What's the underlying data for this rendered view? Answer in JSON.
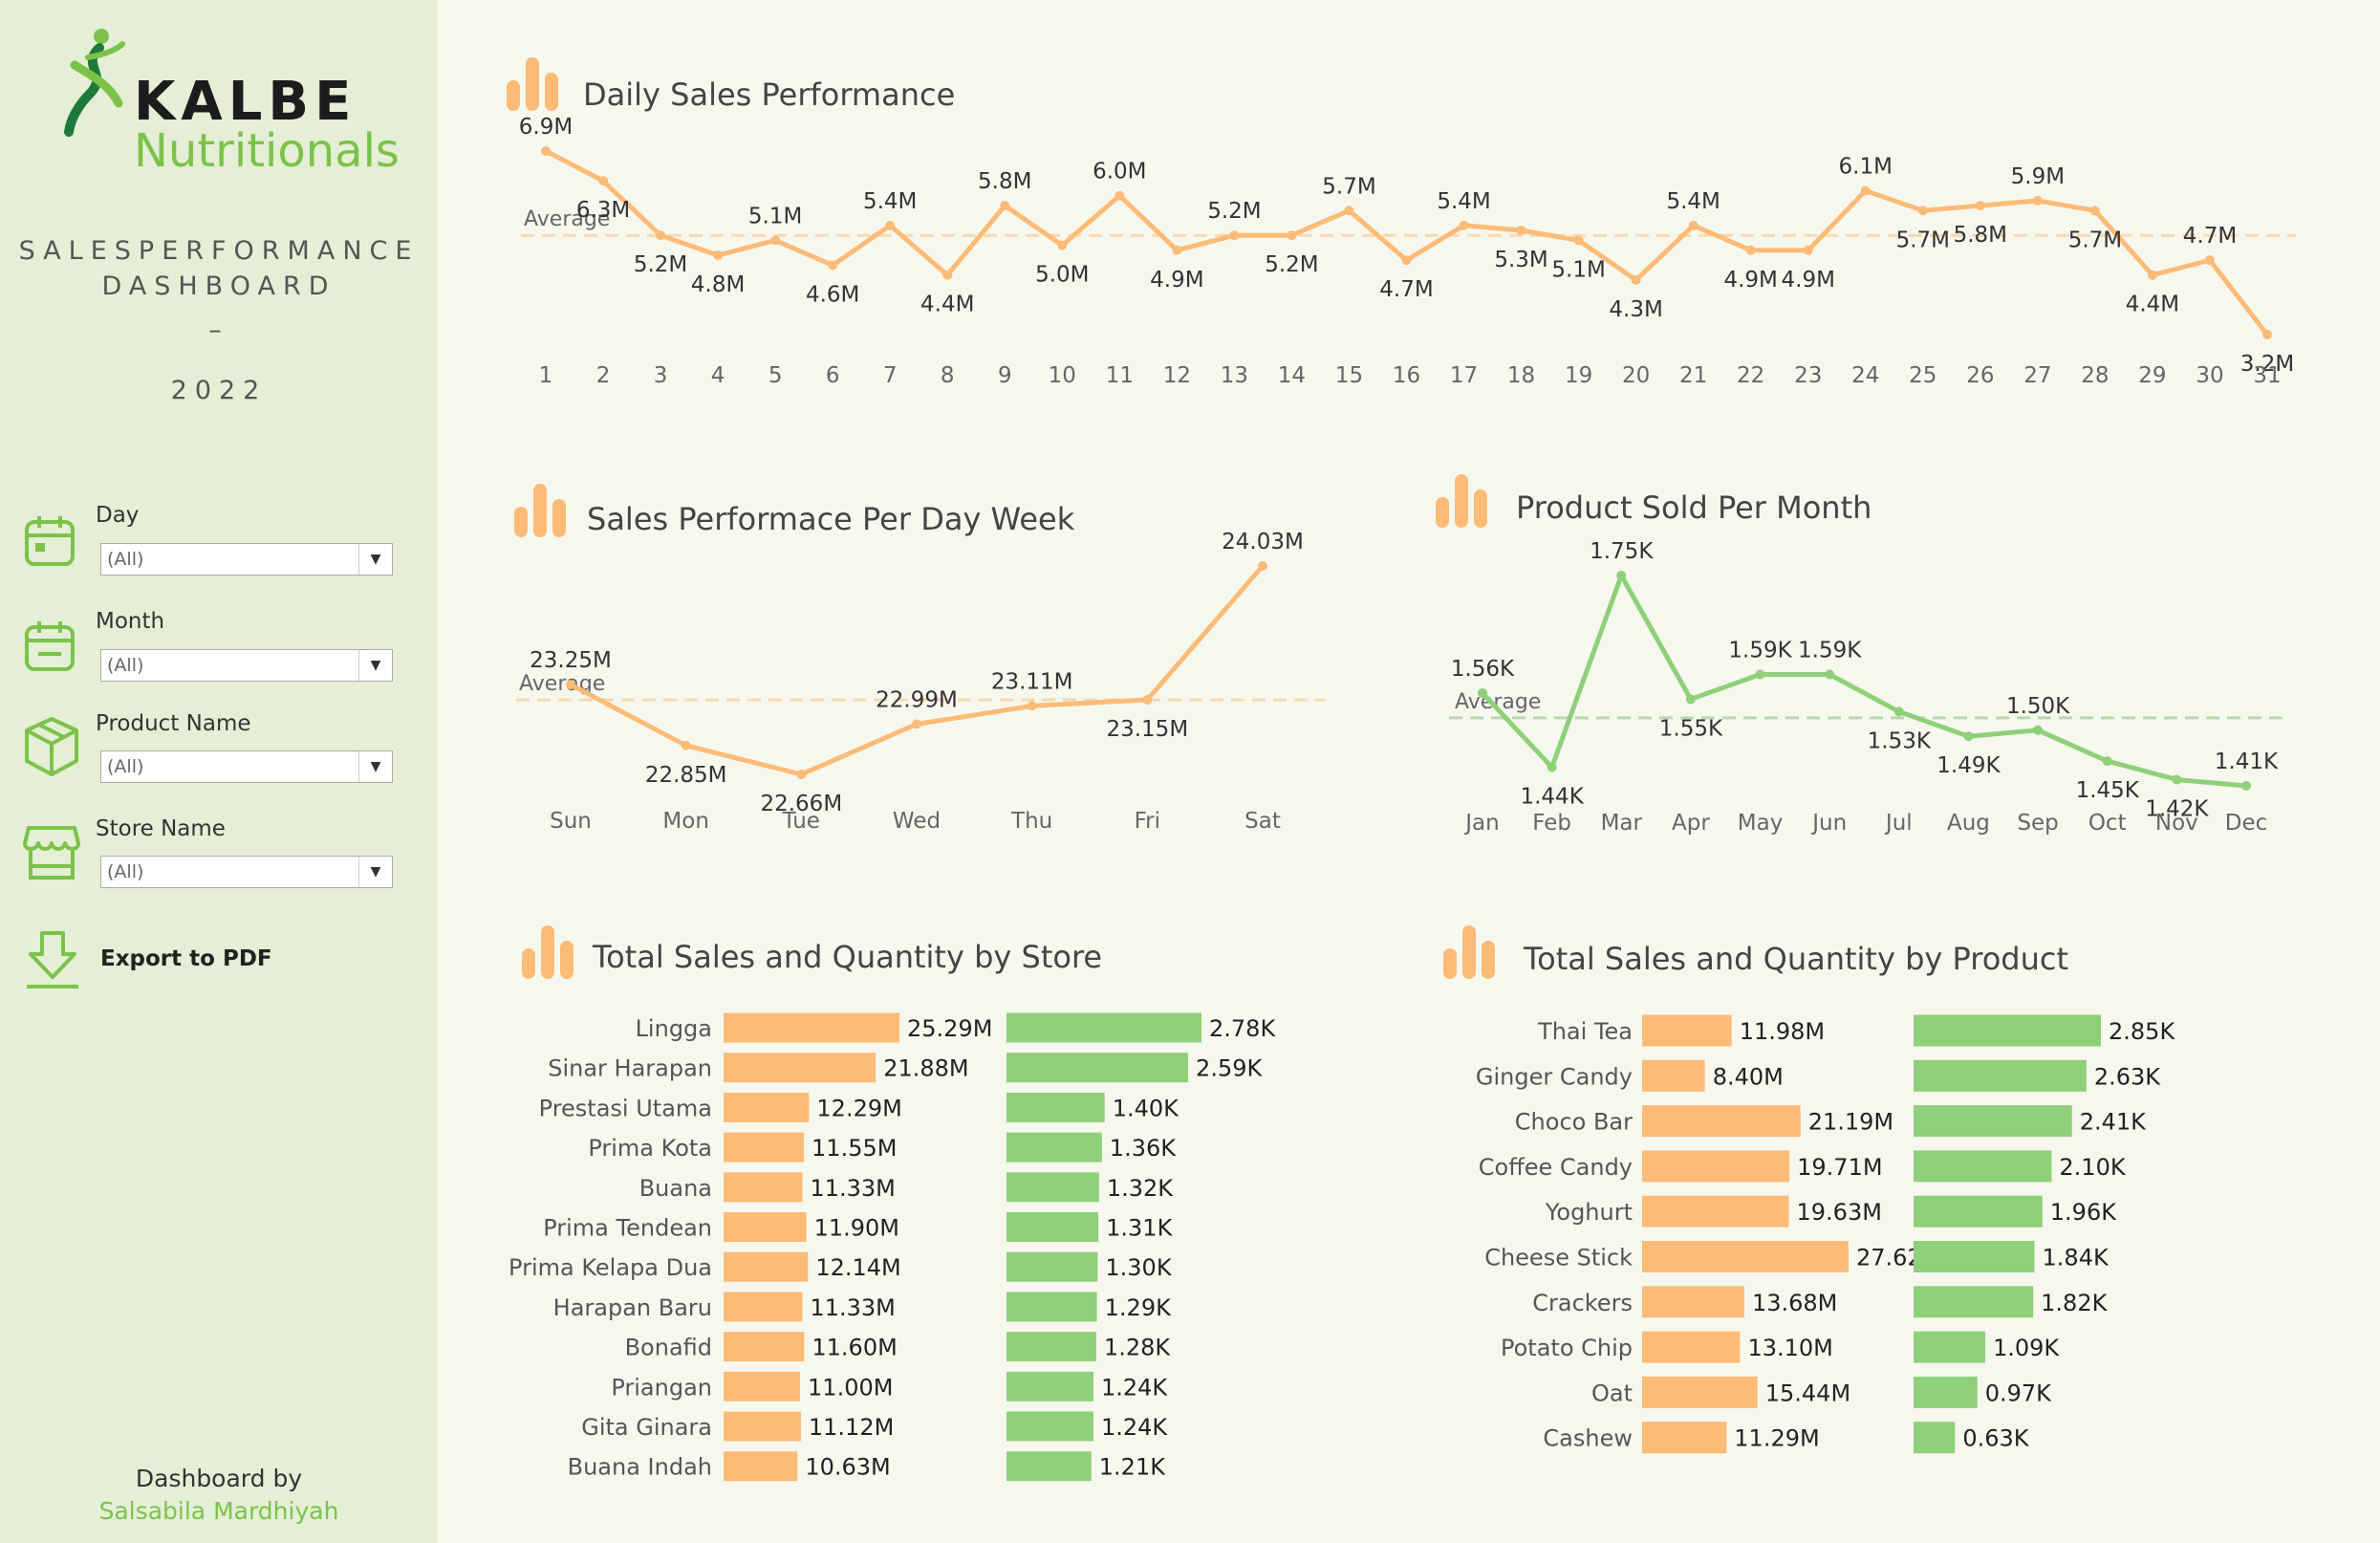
{
  "brand": {
    "name": "KALBE",
    "sub": "Nutritionals"
  },
  "dashboard": {
    "title1": "SALESPERFORMANCE",
    "title2": "DASHBOARD",
    "dash": "–",
    "year": "2022"
  },
  "filters": [
    {
      "label": "Day",
      "value": "(All)",
      "icon": "calendar-icon"
    },
    {
      "label": "Month",
      "value": "(All)",
      "icon": "calendar-minus-icon"
    },
    {
      "label": "Product Name",
      "value": "(All)",
      "icon": "box-icon"
    },
    {
      "label": "Store Name",
      "value": "(All)",
      "icon": "store-icon"
    }
  ],
  "export": {
    "label": "Export to PDF",
    "icon": "download-icon"
  },
  "credit": {
    "line1": "Dashboard by",
    "author": "Salsabila Mardhiyah"
  },
  "colors": {
    "orange": "#fdbb78",
    "green": "#8fd07a",
    "sidebar": "#e4efd6",
    "bg": "#f6f8ee",
    "brand_green": "#7cc24a"
  },
  "titles": {
    "daily": "Daily Sales Performance",
    "weekday": "Sales Performace Per Day Week",
    "monthly": "Product Sold Per Month",
    "store": "Total Sales and Quantity by Store",
    "product": "Total Sales and Quantity by Product"
  },
  "chart_data": [
    {
      "id": "daily",
      "type": "line",
      "x": [
        1,
        2,
        3,
        4,
        5,
        6,
        7,
        8,
        9,
        10,
        11,
        12,
        13,
        14,
        15,
        16,
        17,
        18,
        19,
        20,
        21,
        22,
        23,
        24,
        25,
        26,
        27,
        28,
        29,
        30,
        31
      ],
      "values": [
        6.9,
        6.3,
        5.2,
        4.8,
        5.1,
        4.6,
        5.4,
        4.4,
        5.8,
        5.0,
        6.0,
        4.9,
        5.2,
        5.2,
        5.7,
        4.7,
        5.4,
        5.3,
        5.1,
        4.3,
        5.4,
        4.9,
        4.9,
        6.1,
        5.7,
        5.8,
        5.9,
        5.7,
        4.4,
        4.7,
        3.2
      ],
      "labels": [
        "6.9M",
        "6.3M",
        "5.2M",
        "4.8M",
        "5.1M",
        "4.6M",
        "5.4M",
        "4.4M",
        "5.8M",
        "5.0M",
        "6.0M",
        "4.9M",
        "5.2M",
        "5.2M",
        "5.7M",
        "4.7M",
        "5.4M",
        "5.3M",
        "5.1M",
        "4.3M",
        "5.4M",
        "4.9M",
        "4.9M",
        "6.1M",
        "5.7M",
        "5.8M",
        "5.9M",
        "5.7M",
        "4.4M",
        "4.7M",
        "3.2M"
      ],
      "average_label": "Average",
      "average": 5.2,
      "color": "#fdbb78"
    },
    {
      "id": "weekday",
      "type": "line",
      "categories": [
        "Sun",
        "Mon",
        "Tue",
        "Wed",
        "Thu",
        "Fri",
        "Sat"
      ],
      "values": [
        23.25,
        22.85,
        22.66,
        22.99,
        23.11,
        23.15,
        24.03
      ],
      "labels": [
        "23.25M",
        "22.85M",
        "22.66M",
        "22.99M",
        "23.11M",
        "23.15M",
        "24.03M"
      ],
      "average_label": "Average",
      "average": 23.15,
      "color": "#fdbb78"
    },
    {
      "id": "monthly",
      "type": "line",
      "categories": [
        "Jan",
        "Feb",
        "Mar",
        "Apr",
        "May",
        "Jun",
        "Jul",
        "Aug",
        "Sep",
        "Oct",
        "Nov",
        "Dec"
      ],
      "values": [
        1.56,
        1.44,
        1.75,
        1.55,
        1.59,
        1.59,
        1.53,
        1.49,
        1.5,
        1.45,
        1.42,
        1.41
      ],
      "labels": [
        "1.56K",
        "1.44K",
        "1.75K",
        "1.55K",
        "1.59K",
        "1.59K",
        "1.53K",
        "1.49K",
        "1.50K",
        "1.45K",
        "1.42K",
        "1.41K"
      ],
      "average_label": "Average",
      "average": 1.52,
      "color": "#8fd07a"
    },
    {
      "id": "store",
      "type": "bar",
      "categories": [
        "Lingga",
        "Sinar Harapan",
        "Prestasi Utama",
        "Prima Kota",
        "Buana",
        "Prima Tendean",
        "Prima Kelapa Dua",
        "Harapan Baru",
        "Bonafid",
        "Priangan",
        "Gita Ginara",
        "Buana Indah"
      ],
      "series": [
        {
          "values": [
            25.29,
            21.88,
            12.29,
            11.55,
            11.33,
            11.9,
            12.14,
            11.33,
            11.6,
            11.0,
            11.12,
            10.63
          ],
          "labels": [
            "25.29M",
            "21.88M",
            "12.29M",
            "11.55M",
            "11.33M",
            "11.90M",
            "12.14M",
            "11.33M",
            "11.60M",
            "11.00M",
            "11.12M",
            "10.63M"
          ],
          "color": "#fdbb78"
        },
        {
          "values": [
            2.78,
            2.59,
            1.4,
            1.36,
            1.32,
            1.31,
            1.3,
            1.29,
            1.28,
            1.24,
            1.24,
            1.21
          ],
          "labels": [
            "2.78K",
            "2.59K",
            "1.40K",
            "1.36K",
            "1.32K",
            "1.31K",
            "1.30K",
            "1.29K",
            "1.28K",
            "1.24K",
            "1.24K",
            "1.21K"
          ],
          "color": "#8fd07a"
        }
      ]
    },
    {
      "id": "product",
      "type": "bar",
      "categories": [
        "Thai Tea",
        "Ginger Candy",
        "Choco Bar",
        "Coffee Candy",
        "Yoghurt",
        "Cheese Stick",
        "Crackers",
        "Potato Chip",
        "Oat",
        "Cashew"
      ],
      "series": [
        {
          "values": [
            11.98,
            8.4,
            21.19,
            19.71,
            19.63,
            27.62,
            13.68,
            13.1,
            15.44,
            11.29
          ],
          "labels": [
            "11.98M",
            "8.40M",
            "21.19M",
            "19.71M",
            "19.63M",
            "27.62M",
            "13.68M",
            "13.10M",
            "15.44M",
            "11.29M"
          ],
          "color": "#fdbb78"
        },
        {
          "values": [
            2.85,
            2.63,
            2.41,
            2.1,
            1.96,
            1.84,
            1.82,
            1.09,
            0.97,
            0.63
          ],
          "labels": [
            "2.85K",
            "2.63K",
            "2.41K",
            "2.10K",
            "1.96K",
            "1.84K",
            "1.82K",
            "1.09K",
            "0.97K",
            "0.63K"
          ],
          "color": "#8fd07a"
        }
      ]
    }
  ]
}
